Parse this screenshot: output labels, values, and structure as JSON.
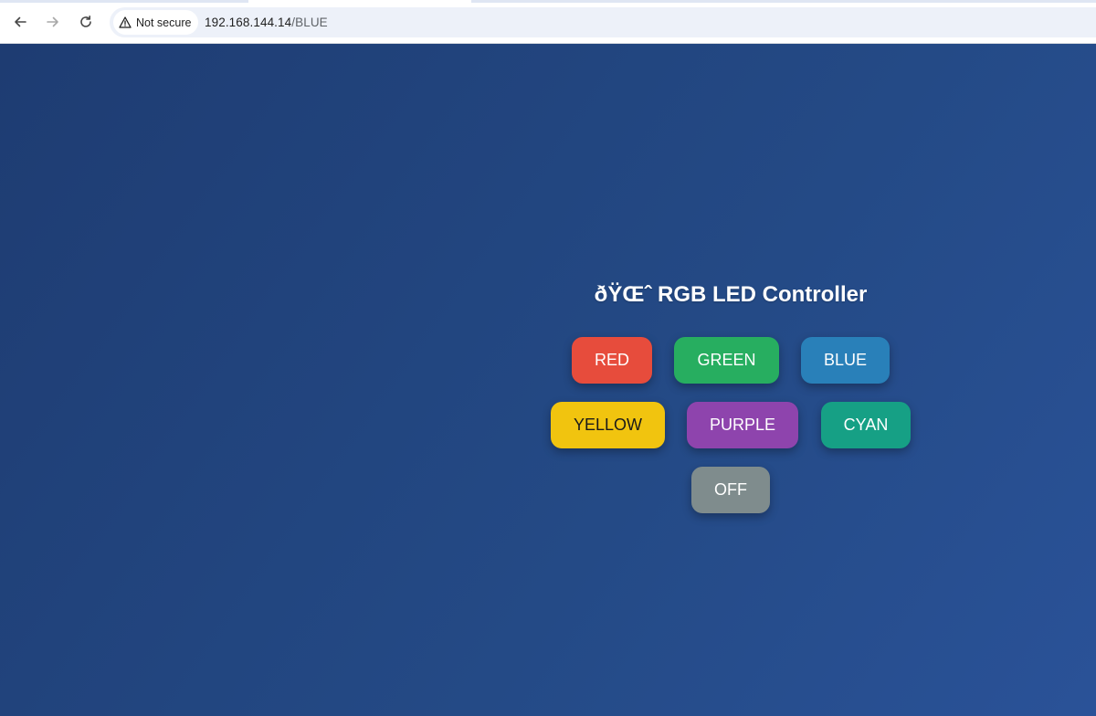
{
  "browser": {
    "security_label": "Not secure",
    "url_host": "192.168.144.14",
    "url_path": "/BLUE"
  },
  "page": {
    "title": "ðŸŒˆ RGB LED Controller"
  },
  "buttons": {
    "red": {
      "label": "RED",
      "color": "#e74c3c"
    },
    "green": {
      "label": "GREEN",
      "color": "#27ae60"
    },
    "blue": {
      "label": "BLUE",
      "color": "#2980b9"
    },
    "yellow": {
      "label": "YELLOW",
      "color": "#f1c40f"
    },
    "purple": {
      "label": "PURPLE",
      "color": "#8e44ad"
    },
    "cyan": {
      "label": "CYAN",
      "color": "#16a085"
    },
    "off": {
      "label": "OFF",
      "color": "#7f8c8d"
    }
  },
  "colors": {
    "page_bg_start": "#1e3c72",
    "page_bg_end": "#2a5298"
  }
}
